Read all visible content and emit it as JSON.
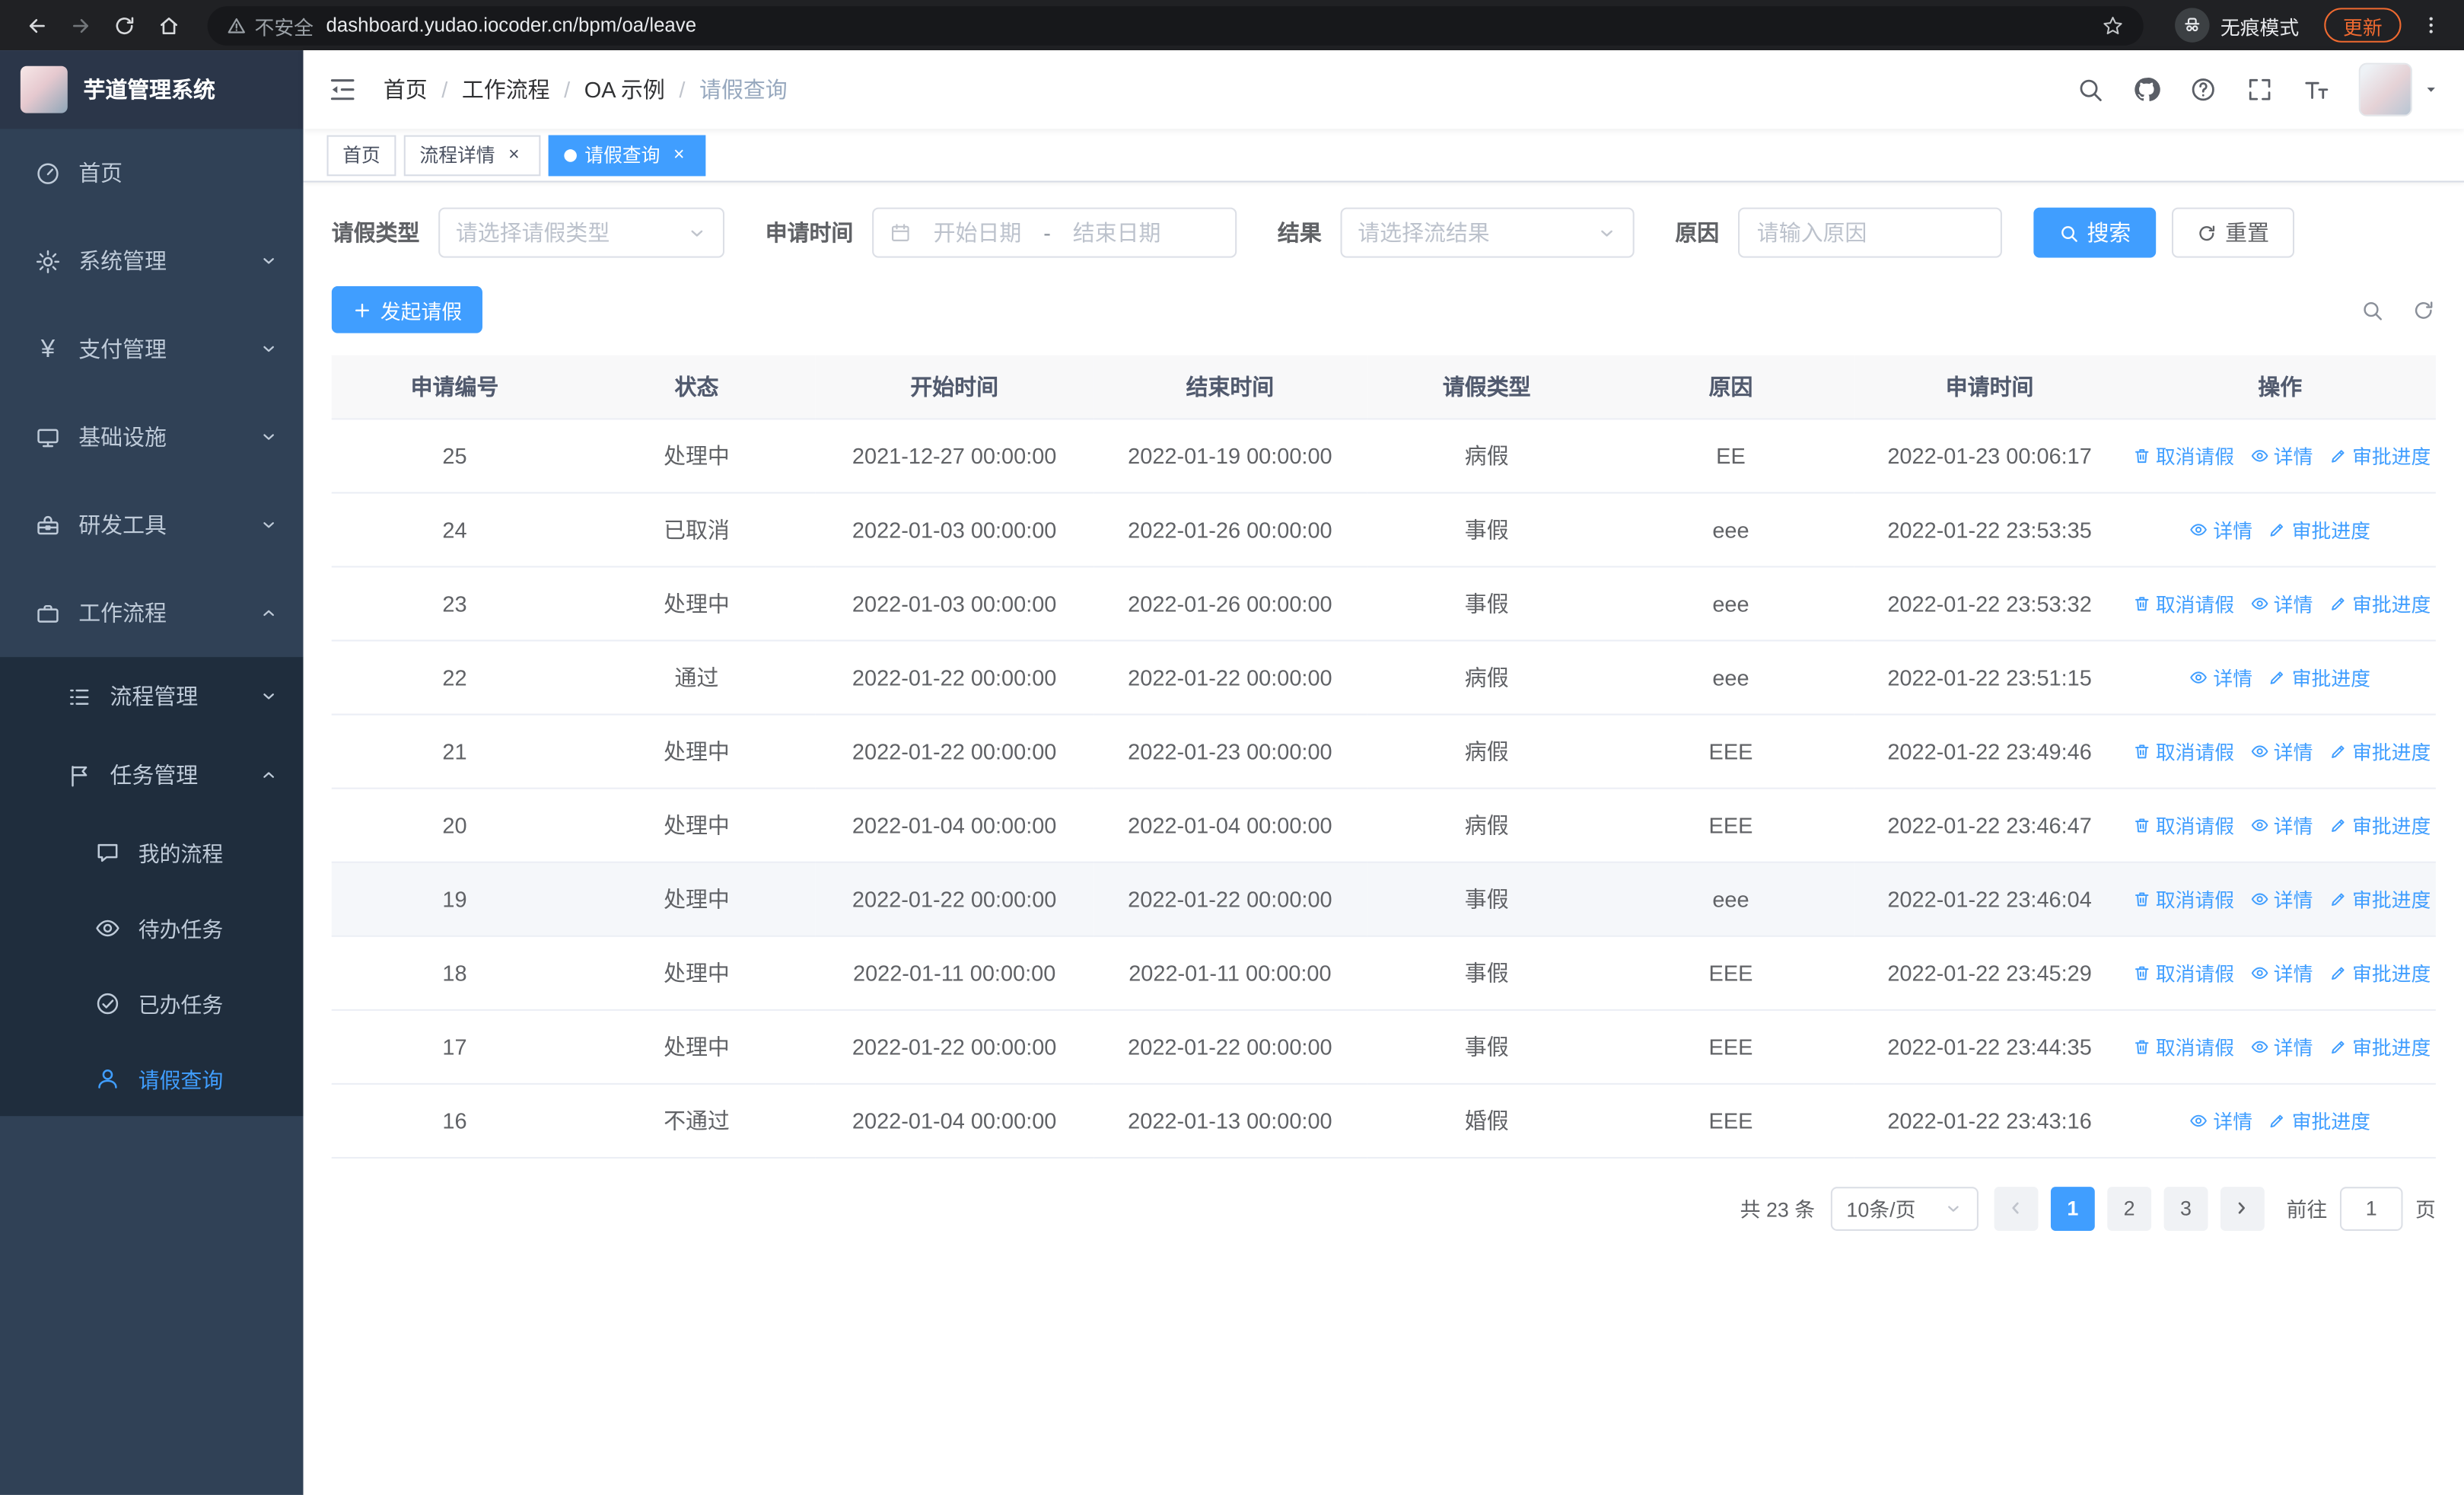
{
  "browser": {
    "security_warning": "不安全",
    "url": "dashboard.yudao.iocoder.cn/bpm/oa/leave",
    "incognito_label": "无痕模式",
    "update_button": "更新"
  },
  "sidebar": {
    "logo_title": "芋道管理系统",
    "items": [
      {
        "label": "首页"
      },
      {
        "label": "系统管理"
      },
      {
        "label": "支付管理"
      },
      {
        "label": "基础设施"
      },
      {
        "label": "研发工具"
      },
      {
        "label": "工作流程"
      }
    ],
    "workflow_children": [
      {
        "label": "流程管理"
      },
      {
        "label": "任务管理"
      }
    ],
    "task_children": [
      {
        "label": "我的流程"
      },
      {
        "label": "待办任务"
      },
      {
        "label": "已办任务"
      },
      {
        "label": "请假查询"
      }
    ]
  },
  "header": {
    "breadcrumb": [
      "首页",
      "工作流程",
      "OA 示例",
      "请假查询"
    ]
  },
  "tabs": [
    {
      "label": "首页"
    },
    {
      "label": "流程详情"
    },
    {
      "label": "请假查询"
    }
  ],
  "filters": {
    "leave_type_label": "请假类型",
    "leave_type_placeholder": "请选择请假类型",
    "apply_time_label": "申请时间",
    "start_date_placeholder": "开始日期",
    "range_separator": "-",
    "end_date_placeholder": "结束日期",
    "result_label": "结果",
    "result_placeholder": "请选择流结果",
    "reason_label": "原因",
    "reason_placeholder": "请输入原因",
    "search_button": "搜索",
    "reset_button": "重置"
  },
  "toolbar": {
    "create_button": "发起请假"
  },
  "table": {
    "headers": [
      "申请编号",
      "状态",
      "开始时间",
      "结束时间",
      "请假类型",
      "原因",
      "申请时间",
      "操作"
    ],
    "actions": {
      "cancel": "取消请假",
      "detail": "详情",
      "progress": "审批进度"
    },
    "rows": [
      {
        "id": "25",
        "status": "处理中",
        "start": "2021-12-27 00:00:00",
        "end": "2022-01-19 00:00:00",
        "type": "病假",
        "reason": "EE",
        "applied": "2022-01-23 00:06:17"
      },
      {
        "id": "24",
        "status": "已取消",
        "start": "2022-01-03 00:00:00",
        "end": "2022-01-26 00:00:00",
        "type": "事假",
        "reason": "eee",
        "applied": "2022-01-22 23:53:35"
      },
      {
        "id": "23",
        "status": "处理中",
        "start": "2022-01-03 00:00:00",
        "end": "2022-01-26 00:00:00",
        "type": "事假",
        "reason": "eee",
        "applied": "2022-01-22 23:53:32"
      },
      {
        "id": "22",
        "status": "通过",
        "start": "2022-01-22 00:00:00",
        "end": "2022-01-22 00:00:00",
        "type": "病假",
        "reason": "eee",
        "applied": "2022-01-22 23:51:15"
      },
      {
        "id": "21",
        "status": "处理中",
        "start": "2022-01-22 00:00:00",
        "end": "2022-01-23 00:00:00",
        "type": "病假",
        "reason": "EEE",
        "applied": "2022-01-22 23:49:46"
      },
      {
        "id": "20",
        "status": "处理中",
        "start": "2022-01-04 00:00:00",
        "end": "2022-01-04 00:00:00",
        "type": "病假",
        "reason": "EEE",
        "applied": "2022-01-22 23:46:47"
      },
      {
        "id": "19",
        "status": "处理中",
        "start": "2022-01-22 00:00:00",
        "end": "2022-01-22 00:00:00",
        "type": "事假",
        "reason": "eee",
        "applied": "2022-01-22 23:46:04"
      },
      {
        "id": "18",
        "status": "处理中",
        "start": "2022-01-11 00:00:00",
        "end": "2022-01-11 00:00:00",
        "type": "事假",
        "reason": "EEE",
        "applied": "2022-01-22 23:45:29"
      },
      {
        "id": "17",
        "status": "处理中",
        "start": "2022-01-22 00:00:00",
        "end": "2022-01-22 00:00:00",
        "type": "事假",
        "reason": "EEE",
        "applied": "2022-01-22 23:44:35"
      },
      {
        "id": "16",
        "status": "不通过",
        "start": "2022-01-04 00:00:00",
        "end": "2022-01-13 00:00:00",
        "type": "婚假",
        "reason": "EEE",
        "applied": "2022-01-22 23:43:16"
      }
    ]
  },
  "pagination": {
    "total_text": "共 23 条",
    "page_size": "10条/页",
    "pages": [
      "1",
      "2",
      "3"
    ],
    "goto_label": "前往",
    "goto_value": "1",
    "goto_suffix": "页"
  },
  "ui": {
    "close_glyph": "×",
    "breadcrumb_separator": "/",
    "yen_glyph": "¥"
  },
  "colors": {
    "primary": "#409eff",
    "sidebar_bg": "#304156",
    "submenu_bg": "#1f2d3d",
    "table_header_bg": "#f8f8f9",
    "update_accent": "#f06a30"
  }
}
